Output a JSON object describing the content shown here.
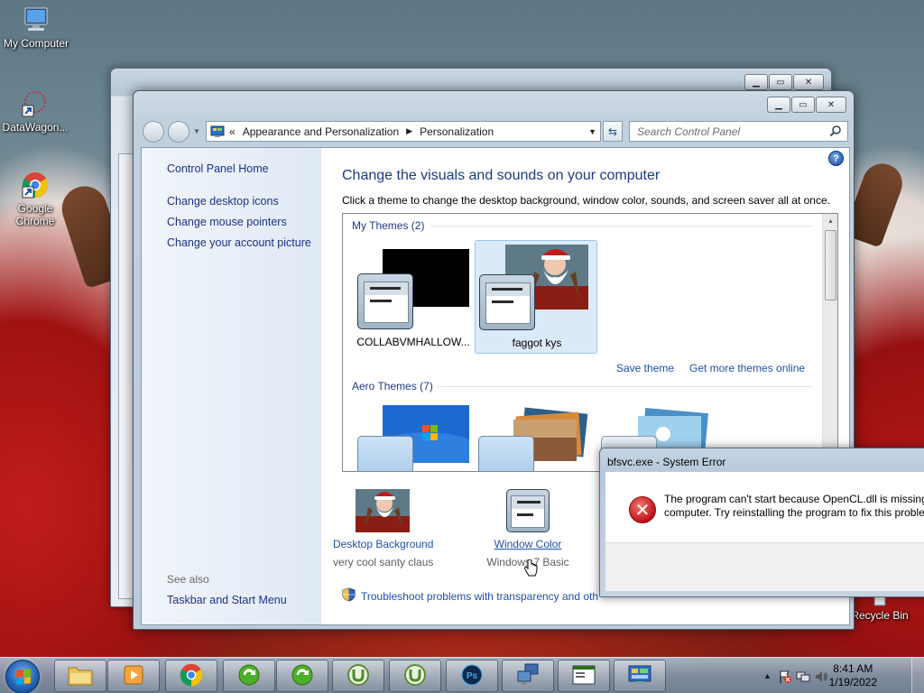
{
  "desktop": {
    "icons": [
      {
        "label": "My Computer"
      },
      {
        "label": "DataWagon..."
      },
      {
        "label": "Google Chrome"
      },
      {
        "label": "Recycle Bin"
      }
    ]
  },
  "window": {
    "breadcrumb": {
      "overflow": "«",
      "items": [
        "Appearance and Personalization",
        "Personalization"
      ]
    },
    "search_placeholder": "Search Control Panel",
    "sidebar": {
      "home": "Control Panel Home",
      "links": [
        "Change desktop icons",
        "Change mouse pointers",
        "Change your account picture"
      ],
      "see_also_label": "See also",
      "see_also_links": [
        "Taskbar and Start Menu"
      ]
    },
    "main": {
      "title": "Change the visuals and sounds on your computer",
      "subtitle": "Click a theme to change the desktop background, window color, sounds, and screen saver all at once.",
      "groups": {
        "my_themes": {
          "header": "My Themes (2)",
          "themes": [
            {
              "name": "COLLABVMHALLOW...",
              "selected": false
            },
            {
              "name": "faggot kys",
              "selected": true
            }
          ]
        },
        "aero_themes": {
          "header": "Aero Themes (7)"
        }
      },
      "links": {
        "save_theme": "Save theme",
        "get_more": "Get more themes online"
      },
      "bottom": [
        {
          "link": "Desktop Background",
          "sub": "very cool santy claus"
        },
        {
          "link": "Window Color",
          "sub": "Windows 7 Basic"
        }
      ],
      "troubleshoot": "Troubleshoot problems with transparency and oth"
    }
  },
  "error_dialog": {
    "title": "bfsvc.exe - System Error",
    "message_line1": "The program can't start because OpenCL.dll is missing",
    "message_line2": "computer. Try reinstalling the program to fix this proble"
  },
  "taskbar": {
    "time": "8:41 AM",
    "date": "1/19/2022",
    "items": [
      "file-explorer",
      "media-player",
      "chrome",
      "app-green-1",
      "app-green-2",
      "utorrent-1",
      "utorrent-2",
      "photoshop",
      "network-app",
      "window-app",
      "control-panel"
    ]
  }
}
